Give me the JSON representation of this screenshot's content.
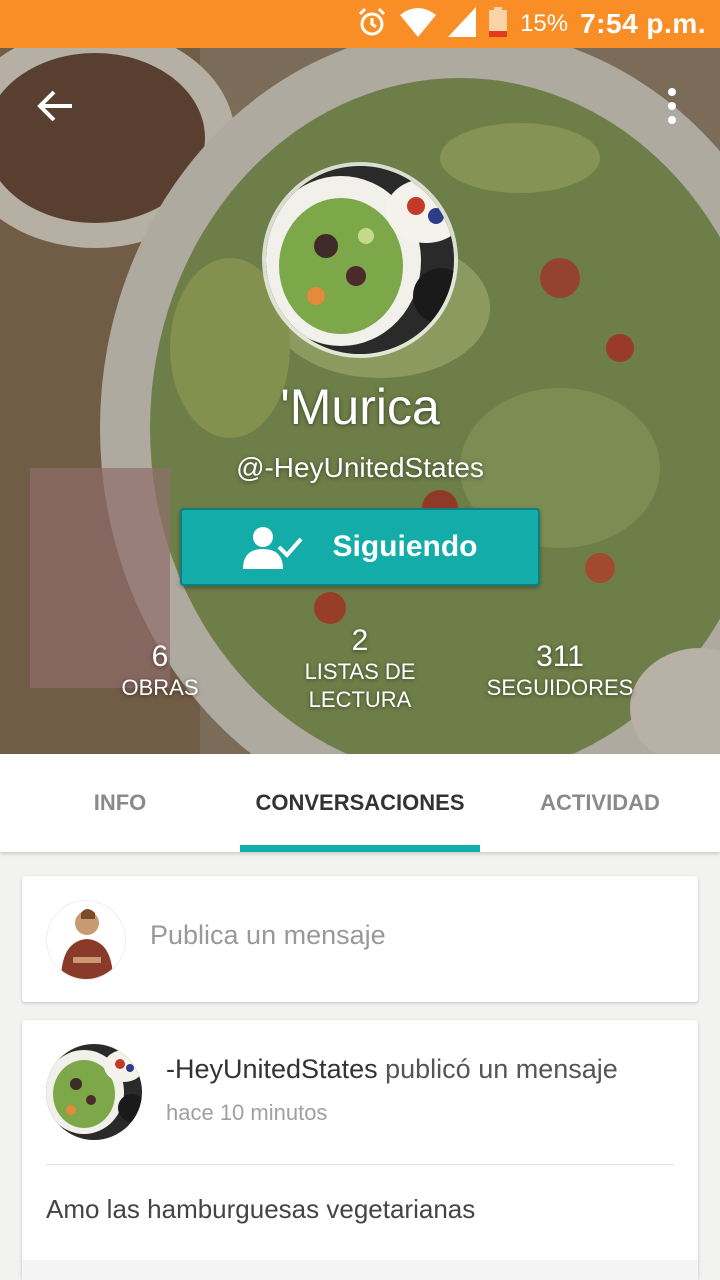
{
  "status_bar": {
    "battery_percent": "15%",
    "time": "7:54 p.m.",
    "icons": [
      "alarm-icon",
      "wifi-icon",
      "signal-icon",
      "battery-icon"
    ],
    "color": "#f88e25"
  },
  "profile": {
    "display_name": "'Murica",
    "username": "@-HeyUnitedStates",
    "follow_button_label": "Siguiendo",
    "stats": [
      {
        "value": "6",
        "label": "OBRAS"
      },
      {
        "value": "2",
        "label": "LISTAS DE LECTURA"
      },
      {
        "value": "311",
        "label": "SEGUIDORES"
      }
    ]
  },
  "tabs": [
    {
      "label": "INFO",
      "active": false
    },
    {
      "label": "CONVERSACIONES",
      "active": true
    },
    {
      "label": "ACTIVIDAD",
      "active": false
    }
  ],
  "compose": {
    "placeholder": "Publica un mensaje"
  },
  "post": {
    "author": "-HeyUnitedStates",
    "action": "publicó un mensaje",
    "time": "hace 10 minutos",
    "body": "Amo las hamburguesas vegetarianas"
  },
  "colors": {
    "accent": "#13aeab",
    "status_bar": "#f88e25"
  }
}
